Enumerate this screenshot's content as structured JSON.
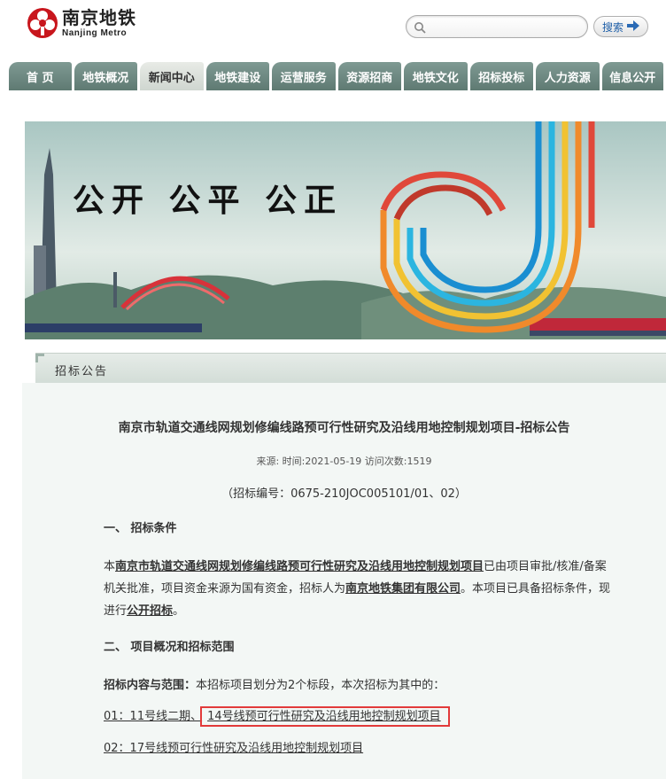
{
  "header": {
    "logo_cn": "南京地铁",
    "logo_en": "Nanjing  Metro",
    "search_placeholder": "",
    "search_button": "搜索"
  },
  "nav": {
    "items": [
      {
        "label": "首  页",
        "width": 71
      },
      {
        "label": "地铁概况",
        "width": 72
      },
      {
        "label": "新闻中心",
        "width": 72,
        "active": true
      },
      {
        "label": "地铁建设",
        "width": 72
      },
      {
        "label": "运营服务",
        "width": 72
      },
      {
        "label": "资源招商",
        "width": 72
      },
      {
        "label": "地铁文化",
        "width": 72
      },
      {
        "label": "招标投标",
        "width": 72
      },
      {
        "label": "人力资源",
        "width": 72
      },
      {
        "label": "信息公开",
        "width": 70
      }
    ]
  },
  "banner": {
    "slogan": "公开  公平  公正"
  },
  "section": {
    "title": "招标公告"
  },
  "article": {
    "title": "南京市轨道交通线网规划修编线路预可行性研究及沿线用地控制规划项目-招标公告",
    "meta": "来源:   时间:2021-05-19  访问次数:1519",
    "code": "（招标编号：0675-210JOC005101/01、02）",
    "h1": "一、    招标条件",
    "p1_pre": "本",
    "p1_project": "南京市轨道交通线网规划修编线路预可行性研究及沿线用地控制规划项目",
    "p1_mid": "已由项目审批/核准/备案机关批准，项目资金来源为国有资金，招标人为",
    "p1_owner": "南京地铁集团有限公司",
    "p1_mid2": "。本项目已具备招标条件，现进行",
    "p1_mode": "公开招标",
    "p1_end": "。",
    "h2": "二、    项目概况和招标范围",
    "scope_label": "招标内容与范围：",
    "scope_text": "本招标项目划分为2个标段，本次招标为其中的：",
    "lot1_pre": "01：11号线二期、",
    "lot1_hl": "14号线预可行性研究及沿线用地控制规划项目",
    "lot2": "02：17号线预可行性研究及沿线用地控制规划项目"
  },
  "colors": {
    "nav_bg": "#6b877f",
    "nav_active": "#dde3de",
    "highlight": "#e23a3a",
    "logo_red": "#c8161d"
  }
}
